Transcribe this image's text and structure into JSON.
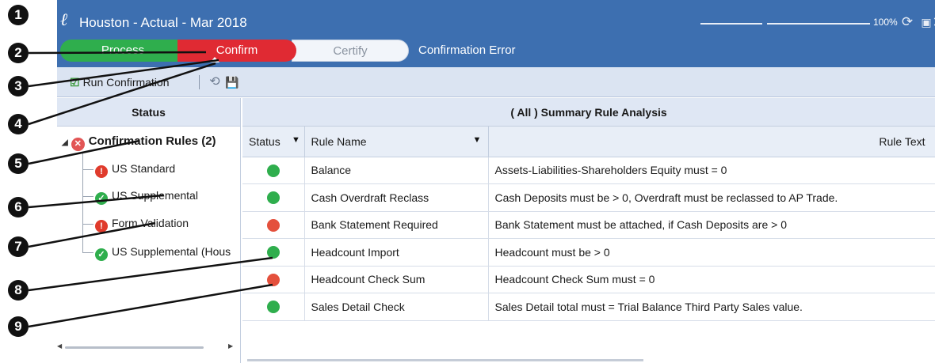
{
  "titlebar": {
    "title": "Houston  -  Actual  -  Mar 2018",
    "zoom_label": "100%",
    "icons": [
      "logo-icon",
      "refresh-icon",
      "popout-icon",
      "close-icon"
    ]
  },
  "workflow": {
    "process_label": "Process",
    "confirm_label": "Confirm",
    "certify_label": "Certify",
    "status_text": "Confirmation Error",
    "colors": {
      "process": "#2fae4d",
      "confirm": "#e02a33",
      "certify": "#f2f5fa"
    }
  },
  "toolbar": {
    "run_label": "Run Confirmation"
  },
  "left_pane": {
    "header": "Status",
    "root": {
      "label": "Confirmation Rules  (2)",
      "status": "error"
    },
    "items": [
      {
        "label": "US Standard",
        "status": "error"
      },
      {
        "label": "US Supplemental",
        "status": "ok"
      },
      {
        "label": "Form Validation",
        "status": "error"
      },
      {
        "label": "US Supplemental (Hous",
        "status": "ok"
      }
    ]
  },
  "right_pane": {
    "header": "( All )  Summary Rule Analysis",
    "columns": {
      "status": "Status",
      "rule_name": "Rule Name",
      "rule_text": "Rule Text"
    },
    "rows": [
      {
        "status": "pass",
        "name": "Balance",
        "text": "Assets-Liabilities-Shareholders Equity must = 0"
      },
      {
        "status": "pass",
        "name": "Cash Overdraft Reclass",
        "text": "Cash Deposits must be > 0, Overdraft must be reclassed to AP Trade."
      },
      {
        "status": "fail",
        "name": "Bank Statement Required",
        "text": "Bank Statement must be attached, if Cash Deposits are > 0"
      },
      {
        "status": "pass",
        "name": "Headcount Import",
        "text": "Headcount must be > 0"
      },
      {
        "status": "fail",
        "name": "Headcount Check Sum",
        "text": "Headcount Check Sum must = 0"
      },
      {
        "status": "pass",
        "name": "Sales Detail Check",
        "text": "Sales Detail total must = Trial Balance Third Party Sales value."
      }
    ],
    "status_colors": {
      "pass": "#2fae4d",
      "fail": "#e4503c"
    }
  },
  "callouts": [
    "1",
    "2",
    "3",
    "4",
    "5",
    "6",
    "7",
    "8",
    "9"
  ]
}
